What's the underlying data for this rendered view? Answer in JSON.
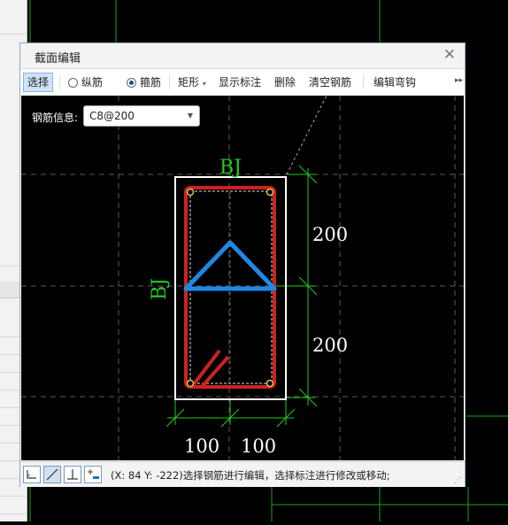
{
  "window": {
    "title": "截面编辑"
  },
  "toolbar": {
    "select": "选择",
    "longitudinal": "纵筋",
    "stirrup": "箍筋",
    "shape": "矩形",
    "show_dims": "显示标注",
    "delete": "删除",
    "clear": "清空钢筋",
    "edit_hook": "编辑弯钩"
  },
  "rebar_info": {
    "label": "钢筋信息:",
    "value": "C8@200"
  },
  "drawing": {
    "label_top": "BJ",
    "label_left": "BJ",
    "dim_right_top": "200",
    "dim_right_bottom": "200",
    "dim_bottom_left": "100",
    "dim_bottom_right": "100"
  },
  "status": {
    "text": "(X: 84 Y: -222)选择钢筋进行编辑，选择标注进行修改或移动;"
  },
  "colors": {
    "stirrup": "#cc2222",
    "tie": "#1e88e5",
    "outline": "#ffffff",
    "dimension": "#22cc22",
    "selection": "#cfe3f7"
  },
  "icons": [
    "close-icon",
    "dropdown-arrow-icon",
    "more-icon",
    "snap-corner-icon",
    "snap-line-icon",
    "snap-perpendicular-icon",
    "snap-add-icon",
    "resize-grip-icon"
  ]
}
